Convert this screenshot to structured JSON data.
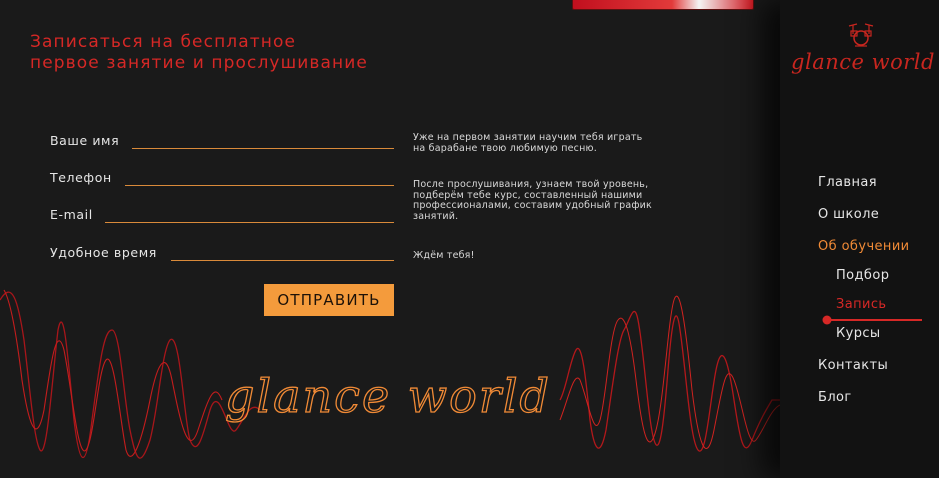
{
  "headline": {
    "line1": "Записаться на бесплатное",
    "line2": "первое занятие и прослушивание"
  },
  "form": {
    "fields": [
      {
        "label": "Ваше имя",
        "value": ""
      },
      {
        "label": "Телефон",
        "value": ""
      },
      {
        "label": "E-mail",
        "value": ""
      },
      {
        "label": "Удобное время",
        "value": ""
      }
    ],
    "submit_label": "ОТПРАВИТЬ"
  },
  "info": {
    "paragraph1": [
      "Уже на первом занятии научим тебя играть",
      "на барабане твою любимую песню."
    ],
    "paragraph2": [
      "После прослушивания, узнаем твой уровень,",
      "подберём тебе курс, составленный нашими",
      "профессионалами, составим удобный график",
      "занятий."
    ],
    "paragraph3": [
      "Ждём тебя!"
    ]
  },
  "brand": {
    "name": "glance world",
    "watermark": "glance world",
    "icon": "drum-kit-icon"
  },
  "nav": {
    "items": [
      {
        "label": "Главная"
      },
      {
        "label": "О школе"
      },
      {
        "label": "Об обучении"
      },
      {
        "label": "Подбор"
      },
      {
        "label": "Запись"
      },
      {
        "label": "Курсы"
      },
      {
        "label": "Контакты"
      },
      {
        "label": "Блог"
      }
    ]
  },
  "colors": {
    "background": "#1a1a1a",
    "accent_red": "#d62826",
    "accent_orange": "#f49b3c",
    "text": "#e6e6e6"
  }
}
